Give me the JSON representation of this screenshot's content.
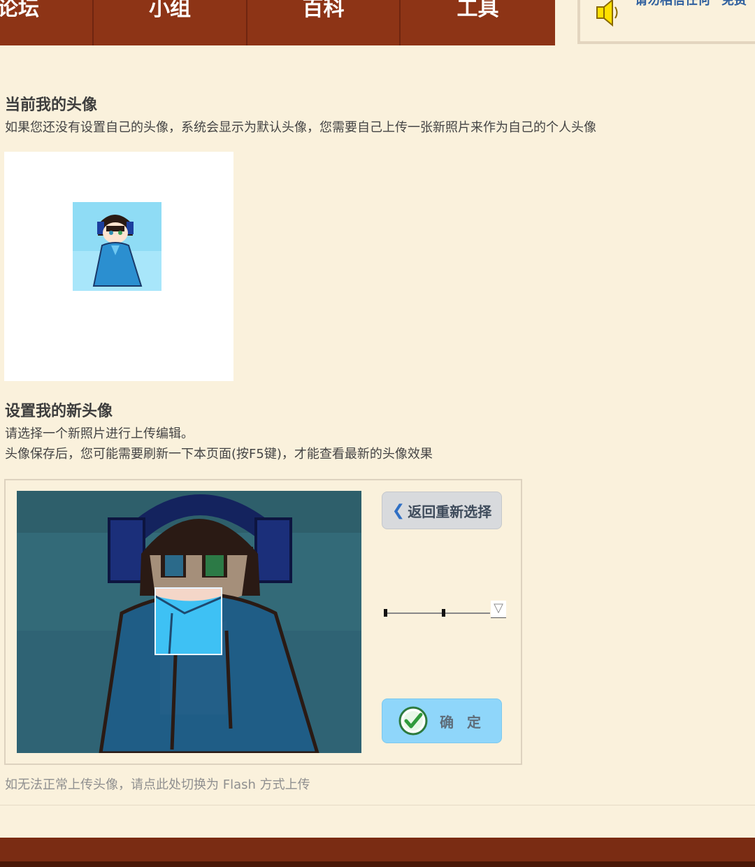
{
  "nav": {
    "tabs": [
      "论坛",
      "小组",
      "百科",
      "工具"
    ]
  },
  "notice": {
    "items": [
      "请勿相信任何",
      "免费"
    ]
  },
  "current": {
    "title": "当前我的头像",
    "description": "如果您还没有设置自己的头像，系统会显示为默认头像，您需要自己上传一张新照片来作为自己的个人头像"
  },
  "new_avatar": {
    "title": "设置我的新头像",
    "line1": "请选择一个新照片进行上传编辑。",
    "line2": "头像保存后，您可能需要刷新一下本页面(按F5键)，才能查看最新的头像效果"
  },
  "editor": {
    "back_button": "返回重新选择",
    "confirm_button": "确 定",
    "zoom_max_icon": "▽"
  },
  "flash_link": "如无法正常上传头像，请点此处切换为 Flash 方式上传",
  "colors": {
    "nav_bg": "#8d3416",
    "page_bg": "#faf1dc",
    "confirm_bg": "#8fd6fa",
    "link_blue": "#2e5f9e"
  }
}
